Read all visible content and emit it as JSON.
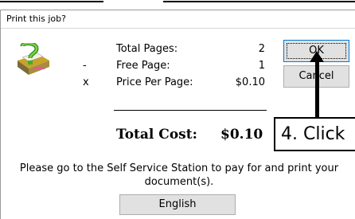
{
  "dialog": {
    "title": "Print this job?"
  },
  "summary": {
    "rows": [
      {
        "operator": "",
        "label": "Total Pages:",
        "value": "2"
      },
      {
        "operator": "-",
        "label": "Free Page:",
        "value": "1"
      },
      {
        "operator": "x",
        "label": "Price Per Page:",
        "value": "$0.10"
      }
    ],
    "total_label": "Total Cost:",
    "total_value": "$0.10"
  },
  "message": "Please go to the Self Service Station to pay for and print your document(s).",
  "buttons": {
    "ok": "OK",
    "cancel": "Cancel",
    "language": "English"
  },
  "annotation": {
    "callout_text": "4. Click"
  },
  "icons": {
    "printer": "printer-question-icon"
  }
}
